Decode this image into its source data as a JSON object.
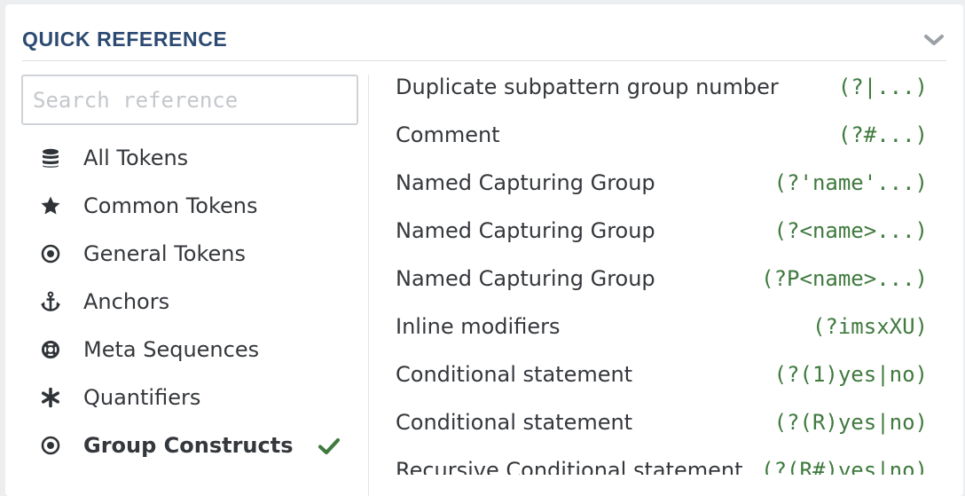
{
  "header": {
    "title": "QUICK REFERENCE",
    "collapse_icon": "chevron-down-icon"
  },
  "search": {
    "placeholder": "Search reference",
    "value": ""
  },
  "categories": [
    {
      "label": "All Tokens",
      "icon": "database-icon",
      "active": false
    },
    {
      "label": "Common Tokens",
      "icon": "star-icon",
      "active": false
    },
    {
      "label": "General Tokens",
      "icon": "dot-circle-icon",
      "active": false
    },
    {
      "label": "Anchors",
      "icon": "anchor-icon",
      "active": false
    },
    {
      "label": "Meta Sequences",
      "icon": "life-ring-icon",
      "active": false
    },
    {
      "label": "Quantifiers",
      "icon": "asterisk-icon",
      "active": false
    },
    {
      "label": "Group Constructs",
      "icon": "dot-circle-icon",
      "active": true,
      "indicator": "checkmark-icon"
    }
  ],
  "references": [
    {
      "description": "Duplicate subpattern group number",
      "token": "(?|...)"
    },
    {
      "description": "Comment",
      "token": "(?#...)"
    },
    {
      "description": "Named Capturing Group",
      "token": "(?'name'...)"
    },
    {
      "description": "Named Capturing Group",
      "token": "(?<name>...)"
    },
    {
      "description": "Named Capturing Group",
      "token": "(?P<name>...)"
    },
    {
      "description": "Inline modifiers",
      "token": "(?imsxXU)"
    },
    {
      "description": "Conditional statement",
      "token": "(?(1)yes|no)"
    },
    {
      "description": "Conditional statement",
      "token": "(?(R)yes|no)"
    },
    {
      "description": "Recursive Conditional statement",
      "token": "(?(R#)yes|no)"
    }
  ],
  "colors": {
    "title": "#2c4a72",
    "token": "#3f7a3e",
    "check": "#3f7a3e",
    "icon": "#2f3337",
    "text": "#34373b"
  }
}
